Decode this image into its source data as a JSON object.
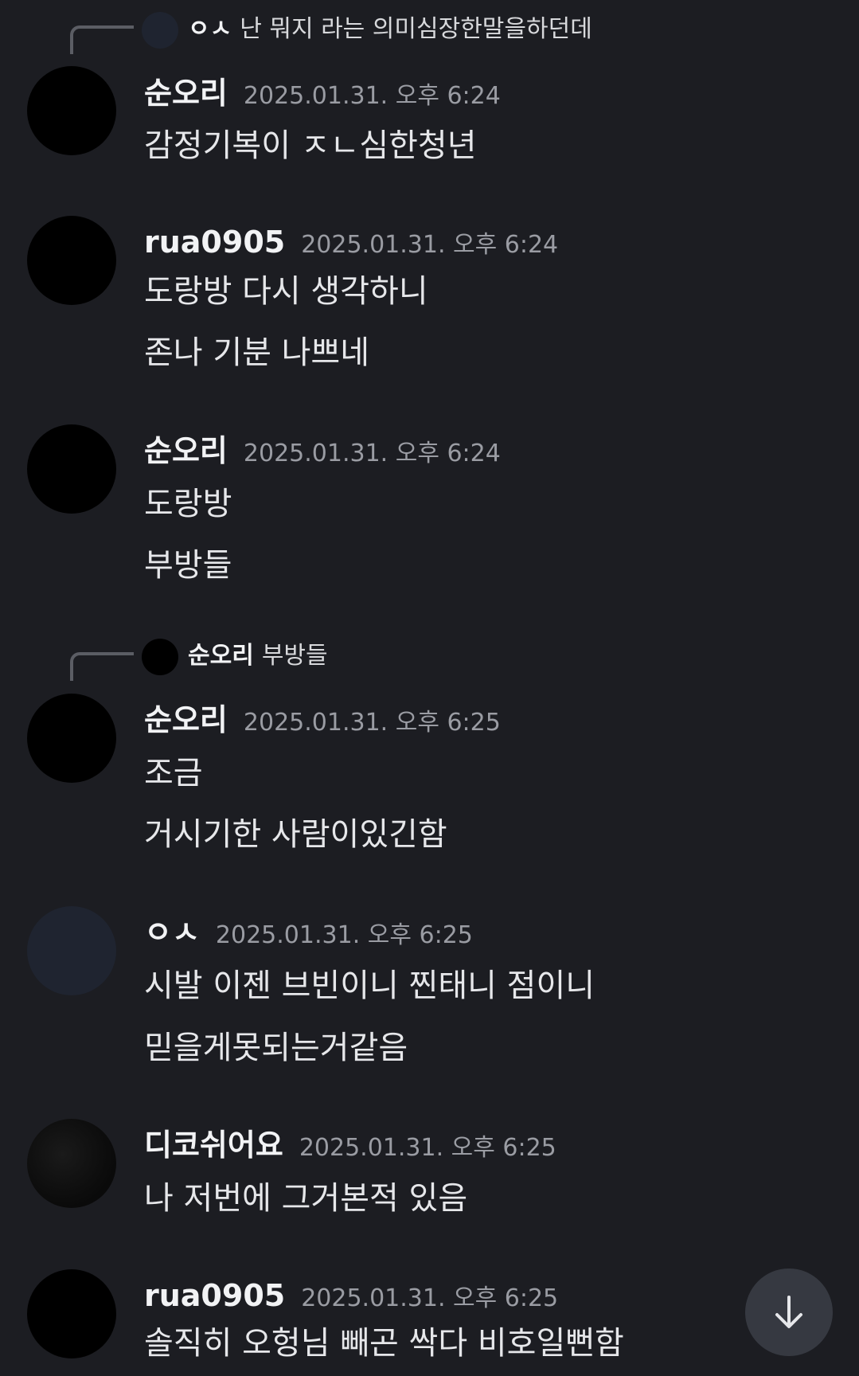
{
  "reply1": {
    "author": "ㅇㅅ",
    "text": "난 뭐지 라는 의미심장한말을하던데"
  },
  "messages": [
    {
      "author": "순오리",
      "time": "2025.01.31. 오후 6:24",
      "lines": [
        "감정기복이 ㅈㄴ심한청년"
      ]
    },
    {
      "author": "rua0905",
      "time": "2025.01.31. 오후 6:24",
      "lines": [
        "도랑방 다시 생각하니",
        "존나 기분 나쁘네"
      ]
    },
    {
      "author": "순오리",
      "time": "2025.01.31. 오후 6:24",
      "lines": [
        "도랑방",
        "부방들"
      ]
    },
    {
      "author": "순오리",
      "time": "2025.01.31. 오후 6:25",
      "lines": [
        "조금",
        "거시기한 사람이있긴함"
      ]
    },
    {
      "author": "ㅇㅅ",
      "time": "2025.01.31. 오후 6:25",
      "lines": [
        "시발 이젠 브빈이니 찐태니 점이니",
        "믿을게못되는거같음"
      ]
    },
    {
      "author": "디코쉬어요",
      "time": "2025.01.31. 오후 6:25",
      "lines": [
        "나 저번에 그거본적 있음"
      ]
    },
    {
      "author": "rua0905",
      "time": "2025.01.31. 오후 6:25",
      "lines": [
        "솔직히 오헝님 빼곤 싹다 비호일뻔함"
      ]
    }
  ],
  "reply2": {
    "author": "순오리",
    "text": "부방들"
  },
  "icons": {
    "scroll": "arrow-down-icon"
  },
  "colors": {
    "background": "#1c1d22",
    "timestamp": "#9a9ca3",
    "scroll_button": "#363941"
  }
}
